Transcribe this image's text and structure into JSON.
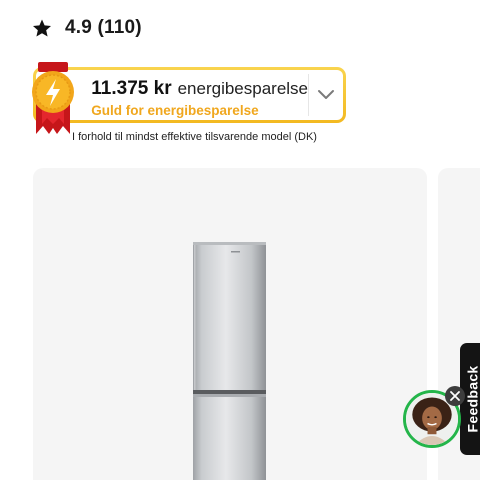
{
  "rating": {
    "value_text": "4.9 (110)",
    "icon": "star-icon"
  },
  "energy_badge": {
    "amount": "11.375 kr",
    "label": "energibesparelse",
    "subtitle": "Guld for energibesparelse",
    "icon": "energy-medal-icon",
    "expand_icon": "chevron-down-icon",
    "accent_color": "#f3b921",
    "subtitle_color": "#f0a71e"
  },
  "note": "I forhold til mindst effektive tilsvarende model (DK)",
  "product": {
    "image": "fridge-freezer-image"
  },
  "feedback": {
    "label": "Feedback"
  },
  "chat": {
    "avatar": "support-agent-avatar",
    "close_icon": "close-icon",
    "ring_color": "#24b54a"
  }
}
